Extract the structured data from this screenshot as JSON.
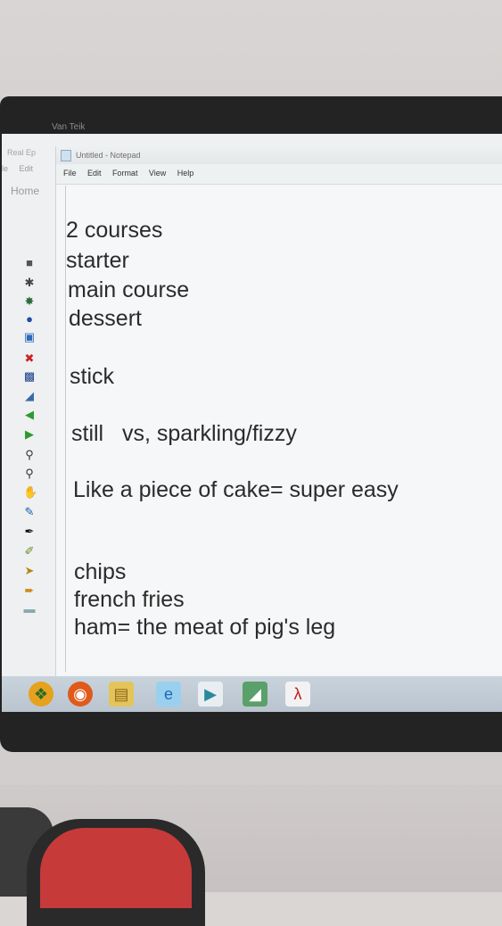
{
  "monitor": {
    "brand": "Van Teik"
  },
  "background_app": {
    "title": "Real Ep",
    "menu": [
      "le",
      "Edit"
    ],
    "home_tab": "Home"
  },
  "notepad": {
    "title": "Untitled - Notepad",
    "menu": [
      "File",
      "Edit",
      "Format",
      "View",
      "Help"
    ],
    "lines": [
      "2 courses",
      "starter",
      "main course",
      "dessert",
      "stick",
      "still   vs, sparkling/fizzy",
      "Like a piece of cake= super easy",
      "chips",
      "french fries",
      "ham= the meat of pig's leg"
    ]
  },
  "toolbar_icons": [
    "lock-icon",
    "star-icon",
    "globe-icon",
    "dot-icon",
    "image-icon",
    "close-circle-icon",
    "save-icon",
    "fill-icon",
    "arrow-left-icon",
    "arrow-right-icon",
    "zoom-in-icon",
    "zoom-out-icon",
    "hand-icon",
    "marker-icon",
    "pen-icon",
    "highlighter-icon",
    "eraser-icon",
    "pointer-icon",
    "line-icon"
  ],
  "taskbar_icons": [
    "start-icon",
    "firefox-icon",
    "file-explorer-icon",
    "internet-explorer-icon",
    "media-player-icon",
    "app-icon",
    "adobe-reader-icon"
  ],
  "colors": {
    "screen_bg": "#eef0f2",
    "text": "#2b2b2b",
    "frame": "#232323",
    "taskbar": "#c3ced8"
  }
}
